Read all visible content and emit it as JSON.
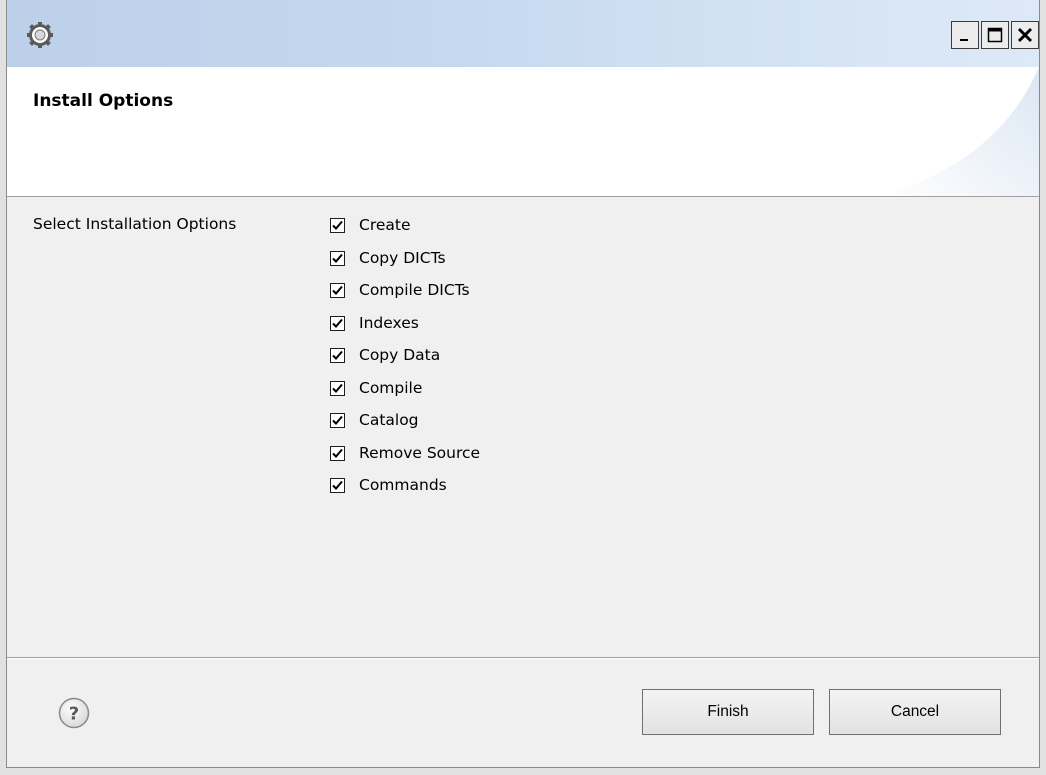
{
  "window": {
    "title_icon": "gear-icon",
    "controls": {
      "minimize_label": "_",
      "maximize_icon": "maximize-icon",
      "close_icon": "close-icon"
    }
  },
  "header": {
    "title": "Install Options"
  },
  "options": {
    "label": "Select Installation Options",
    "items": [
      {
        "label": "Create",
        "checked": true
      },
      {
        "label": "Copy DICTs",
        "checked": true
      },
      {
        "label": "Compile DICTs",
        "checked": true
      },
      {
        "label": "Indexes",
        "checked": true
      },
      {
        "label": "Copy Data",
        "checked": true
      },
      {
        "label": "Compile",
        "checked": true
      },
      {
        "label": "Catalog",
        "checked": true
      },
      {
        "label": "Remove Source",
        "checked": true
      },
      {
        "label": "Commands",
        "checked": true
      }
    ]
  },
  "footer": {
    "help_icon": "help-icon",
    "finish_label": "Finish",
    "cancel_label": "Cancel"
  },
  "colors": {
    "titlebar_gradient_start": "#bcd0ea",
    "titlebar_gradient_end": "#dde9f6",
    "dialog_background": "#f0f0f0",
    "header_background": "#ffffff"
  }
}
